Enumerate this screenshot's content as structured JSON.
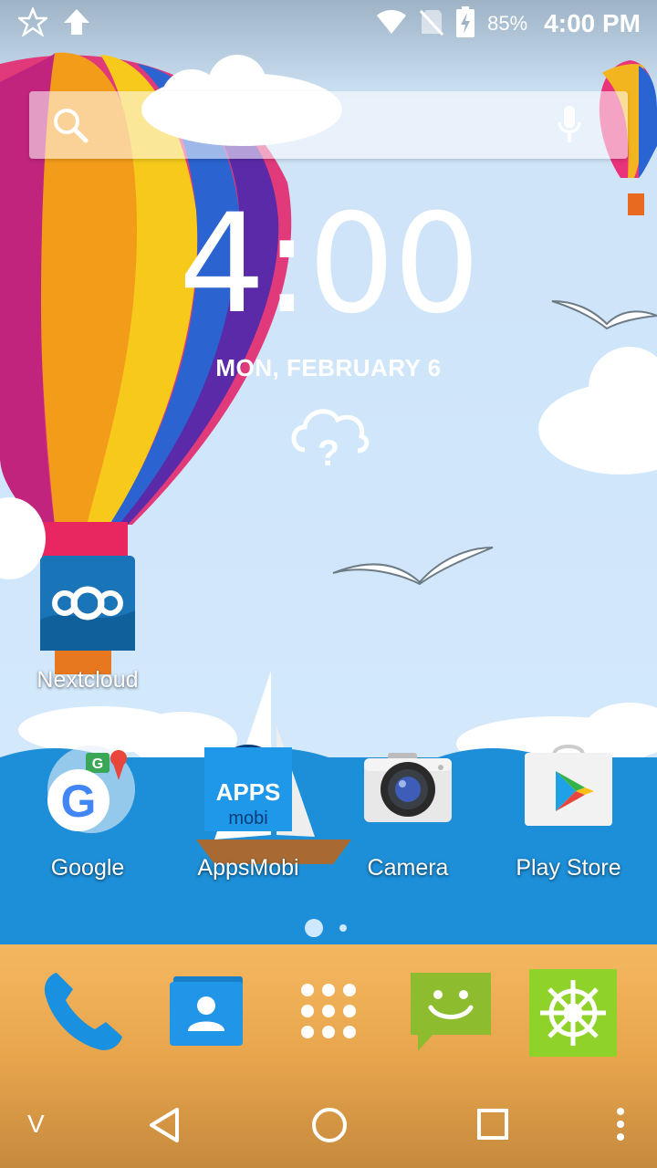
{
  "status_bar": {
    "battery_percent": "85%",
    "time": "4:00 PM"
  },
  "search": {
    "search_icon": "search-icon",
    "mic_icon": "mic-icon"
  },
  "clock": {
    "time": "4:00",
    "date": "MON, FEBRUARY 6",
    "weather_icon": "weather-unknown-icon"
  },
  "apps": {
    "nextcloud": "Nextcloud",
    "google": "Google",
    "appsmobi": "AppsMobi",
    "appsmobi_icon_text_1": "APPS",
    "appsmobi_icon_text_2": "mobi",
    "camera": "Camera",
    "play_store": "Play Store"
  },
  "dock": {
    "phone_icon": "phone-icon",
    "contacts_icon": "contacts-icon",
    "app_drawer_icon": "app-drawer-icon",
    "messaging_icon": "messaging-icon",
    "helm_app_icon": "helm-icon"
  },
  "navbar": {
    "collapse_label": "V"
  },
  "colors": {
    "sea": "#1d8fd8",
    "sand": "#f4b760",
    "sky": "#cfe5fa"
  }
}
